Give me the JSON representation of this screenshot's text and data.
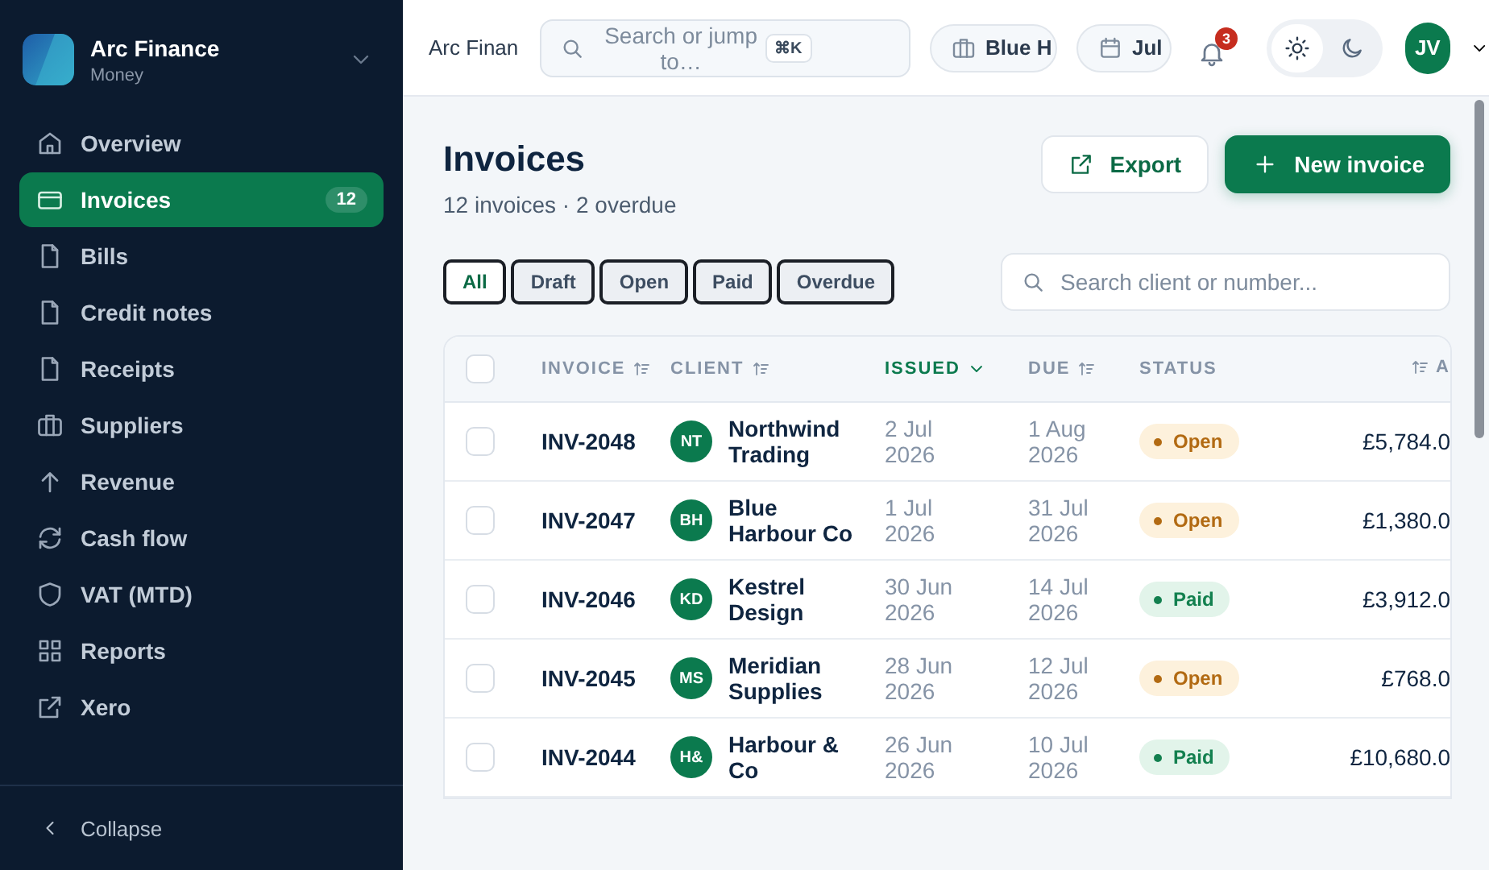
{
  "brand": {
    "name": "Arc Finance",
    "subtitle": "Money"
  },
  "nav": [
    {
      "label": "Overview",
      "selected": false
    },
    {
      "label": "Invoices",
      "selected": true,
      "badge": "12"
    },
    {
      "label": "Bills",
      "selected": false
    },
    {
      "label": "Credit notes",
      "selected": false
    },
    {
      "label": "Receipts",
      "selected": false
    },
    {
      "label": "Suppliers",
      "selected": false
    },
    {
      "label": "Revenue",
      "selected": false
    },
    {
      "label": "Cash flow",
      "selected": false
    },
    {
      "label": "VAT (MTD)",
      "selected": false
    },
    {
      "label": "Reports",
      "selected": false
    },
    {
      "label": "Xero",
      "selected": false
    }
  ],
  "collapse": "Collapse",
  "topbar": {
    "breadcrumb": "Arc Finan",
    "search": {
      "placeholder": "Search or jump to…",
      "shortcut": "⌘K"
    },
    "chips": [
      "Blue H",
      "Jul"
    ],
    "notifications": "3",
    "theme": [
      {
        "selected": true
      },
      {
        "selected": false
      }
    ],
    "avatar": "JV"
  },
  "page": {
    "title": "Invoices",
    "subtitle": "12 invoices · 2 overdue",
    "actions": [
      {
        "label": "Export",
        "kind": "secondary"
      },
      {
        "label": "New invoice",
        "kind": "primary"
      }
    ]
  },
  "filters": [
    {
      "label": "All",
      "selected": true
    },
    {
      "label": "Draft",
      "selected": false
    },
    {
      "label": "Open",
      "selected": false
    },
    {
      "label": "Paid",
      "selected": false
    },
    {
      "label": "Overdue",
      "selected": false
    }
  ],
  "search": {
    "placeholder": "Search client or number..."
  },
  "table": {
    "select_all": {
      "checked": false
    },
    "columns": [
      {
        "label": "INVOICE",
        "sortable": true,
        "sorted": false
      },
      {
        "label": "CLIENT",
        "sortable": true,
        "sorted": false
      },
      {
        "label": "ISSUED",
        "sortable": true,
        "sorted": true
      },
      {
        "label": "DUE",
        "sortable": true,
        "sorted": false
      },
      {
        "label": "STATUS",
        "sortable": false,
        "sorted": false
      },
      {
        "label": "A",
        "sortable": true,
        "sorted": false
      }
    ],
    "rows": [
      {
        "checked": false,
        "invoice": "INV-2048",
        "initials": "NT",
        "client": "Northwind Trading",
        "issued": "2 Jul 2026",
        "due": "1 Aug 2026",
        "status": {
          "label": "Open",
          "kind": "open"
        },
        "amount": "£5,784.0"
      },
      {
        "checked": false,
        "invoice": "INV-2047",
        "initials": "BH",
        "client": "Blue Harbour Co",
        "issued": "1 Jul 2026",
        "due": "31 Jul 2026",
        "status": {
          "label": "Open",
          "kind": "open"
        },
        "amount": "£1,380.0"
      },
      {
        "checked": false,
        "invoice": "INV-2046",
        "initials": "KD",
        "client": "Kestrel Design",
        "issued": "30 Jun 2026",
        "due": "14 Jul 2026",
        "status": {
          "label": "Paid",
          "kind": "paid"
        },
        "amount": "£3,912.0"
      },
      {
        "checked": false,
        "invoice": "INV-2045",
        "initials": "MS",
        "client": "Meridian Supplies",
        "issued": "28 Jun 2026",
        "due": "12 Jul 2026",
        "status": {
          "label": "Open",
          "kind": "open"
        },
        "amount": "£768.0"
      },
      {
        "checked": false,
        "invoice": "INV-2044",
        "initials": "H&",
        "client": "Harbour & Co",
        "issued": "26 Jun 2026",
        "due": "10 Jul 2026",
        "status": {
          "label": "Paid",
          "kind": "paid"
        },
        "amount": "£10,680.0"
      }
    ]
  }
}
